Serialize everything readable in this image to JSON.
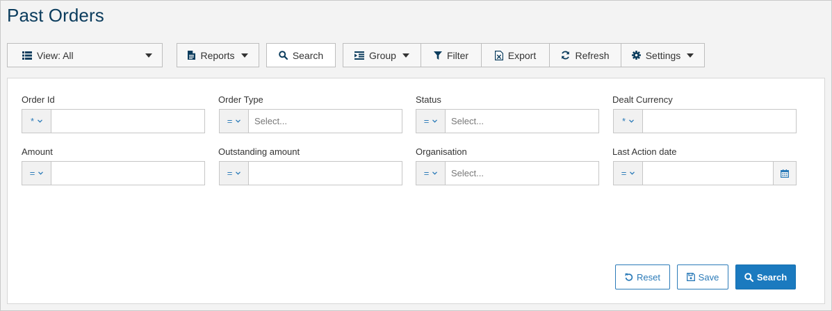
{
  "page": {
    "title": "Past Orders"
  },
  "toolbar": {
    "view_label": "View: All",
    "reports_label": "Reports",
    "search_label": "Search",
    "group_label": "Group",
    "filter_label": "Filter",
    "export_label": "Export",
    "refresh_label": "Refresh",
    "settings_label": "Settings"
  },
  "form": {
    "fields": [
      {
        "label": "Order Id",
        "operator": "*",
        "value": "",
        "placeholder": ""
      },
      {
        "label": "Order Type",
        "operator": "=",
        "value": "",
        "placeholder": "Select..."
      },
      {
        "label": "Status",
        "operator": "=",
        "value": "",
        "placeholder": "Select..."
      },
      {
        "label": "Dealt Currency",
        "operator": "*",
        "value": "",
        "placeholder": ""
      },
      {
        "label": "Amount",
        "operator": "=",
        "value": "",
        "placeholder": ""
      },
      {
        "label": "Outstanding amount",
        "operator": "=",
        "value": "",
        "placeholder": ""
      },
      {
        "label": "Organisation",
        "operator": "=",
        "value": "",
        "placeholder": "Select..."
      },
      {
        "label": "Last Action date",
        "operator": "=",
        "value": "",
        "placeholder": ""
      }
    ]
  },
  "actions": {
    "reset_label": "Reset",
    "save_label": "Save",
    "search_label": "Search"
  },
  "colors": {
    "title": "#0b3c5d",
    "accent": "#1b7abf",
    "operator": "#2a7ab8"
  }
}
